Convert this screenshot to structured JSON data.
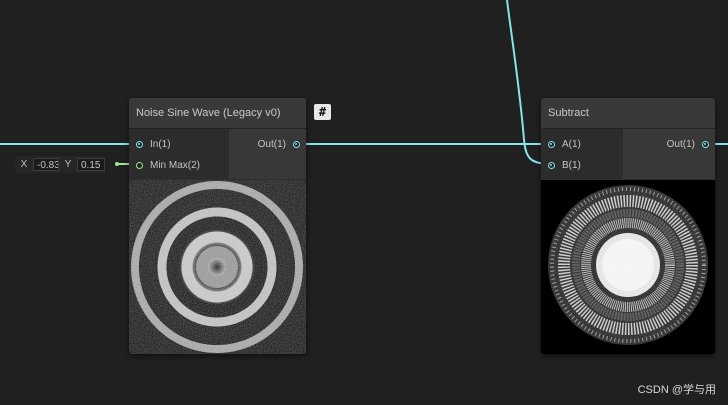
{
  "nodes": {
    "noise": {
      "title": "Noise Sine Wave (Legacy v0)",
      "inputs": [
        {
          "label": "In(1)",
          "type": "cyan"
        },
        {
          "label": "Min Max(2)",
          "type": "green"
        }
      ],
      "output": {
        "label": "Out(1)"
      },
      "badge": "#"
    },
    "subtract": {
      "title": "Subtract",
      "inputs": [
        {
          "label": "A(1)",
          "type": "cyan"
        },
        {
          "label": "B(1)",
          "type": "cyan"
        }
      ],
      "output": {
        "label": "Out(1)"
      }
    }
  },
  "minmax_field": {
    "x_label": "X",
    "x_value": "-0.83",
    "y_label": "Y",
    "y_value": "0.15"
  },
  "colors": {
    "background": "#202020",
    "wire_float": "#84e4e7",
    "wire_vector2": "#9ae98c",
    "node_title": "#393939"
  },
  "watermark": "CSDN @学与用"
}
